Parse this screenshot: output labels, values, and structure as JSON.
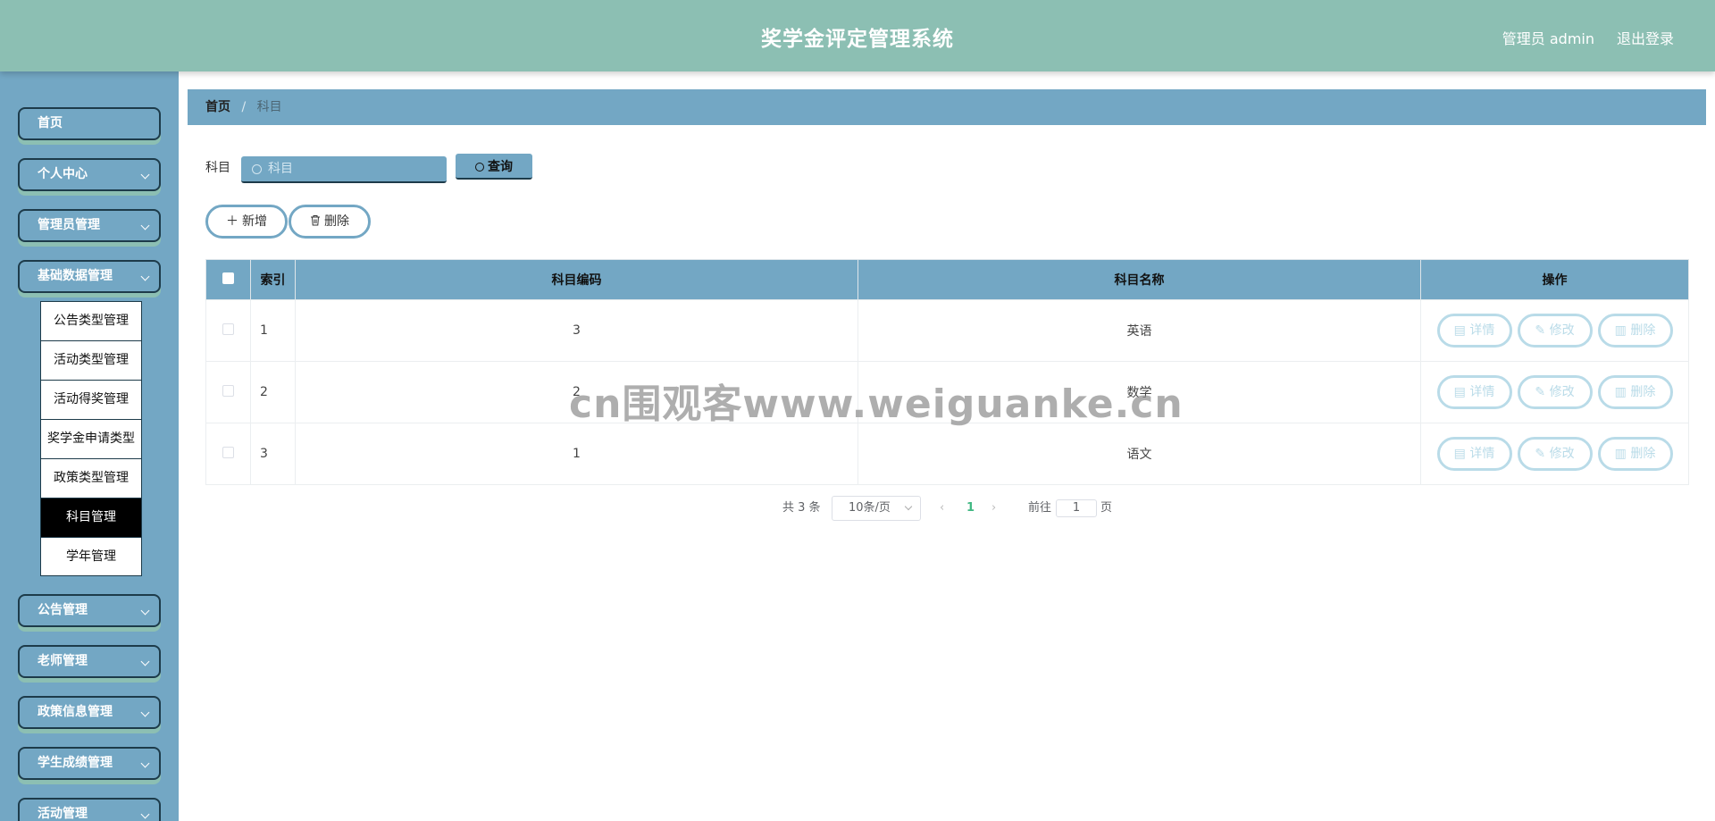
{
  "header": {
    "title": "奖学金评定管理系统",
    "user": "管理员 admin",
    "logout": "退出登录",
    "bg_color": "#8cbfb3"
  },
  "sidebar": {
    "bg_color": "#73a7c4",
    "items": [
      {
        "label": "首页"
      },
      {
        "label": "个人中心"
      },
      {
        "label": "管理员管理"
      },
      {
        "label": "基础数据管理"
      },
      {
        "label": "公告管理"
      },
      {
        "label": "老师管理"
      },
      {
        "label": "政策信息管理"
      },
      {
        "label": "学生成绩管理"
      },
      {
        "label": "活动管理"
      }
    ],
    "submenu": [
      {
        "label": "公告类型管理"
      },
      {
        "label": "活动类型管理"
      },
      {
        "label": "活动得奖管理"
      },
      {
        "label": "奖学金申请类型"
      },
      {
        "label": "政策类型管理"
      },
      {
        "label": "科目管理",
        "active": true
      },
      {
        "label": "学年管理"
      }
    ]
  },
  "breadcrumb": {
    "home": "首页",
    "separator": "/",
    "current": "科目"
  },
  "search": {
    "label": "科目",
    "placeholder": "科目",
    "button": "查询"
  },
  "actions": {
    "add": "新增",
    "delete": "删除"
  },
  "table": {
    "headers": [
      "索引",
      "科目编码",
      "科目名称",
      "操作"
    ],
    "rows": [
      {
        "index": "1",
        "code": "3",
        "name": "英语"
      },
      {
        "index": "2",
        "code": "2",
        "name": "数学"
      },
      {
        "index": "3",
        "code": "1",
        "name": "语文"
      }
    ],
    "row_actions": {
      "detail": "详情",
      "edit": "修改",
      "delete": "删除"
    }
  },
  "pagination": {
    "total": "共 3 条",
    "page_size": "10条/页",
    "current_page": "1",
    "goto_prefix": "前往",
    "goto_value": "1",
    "goto_suffix": "页"
  },
  "watermark": "cn围观客www.weiguanke.cn"
}
